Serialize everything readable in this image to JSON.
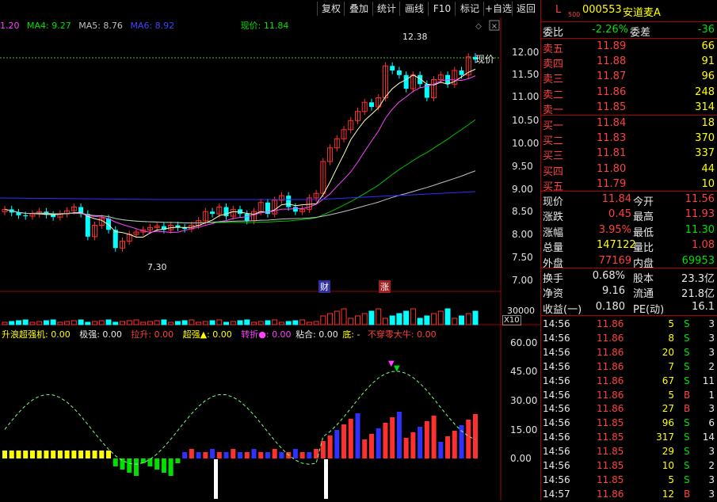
{
  "toolbar": {
    "buttons": [
      "复权",
      "叠加",
      "统计",
      "画线",
      "F10",
      "标记",
      "+自选",
      "返回"
    ]
  },
  "ma_legend": {
    "ma_prefix": "1.20",
    "ma4": "MA4: 9.27",
    "ma5": "MA5: 8.76",
    "ma6": "MA6: 8.92",
    "current_price_label": "现价: 11.84"
  },
  "price_axis": [
    "12.00",
    "11.50",
    "11.00",
    "10.50",
    "10.00",
    "9.50",
    "9.00",
    "8.50",
    "8.00",
    "7.50",
    "7.00"
  ],
  "annotations": {
    "high": "12.38",
    "low": "7.30",
    "now_tag": "现价",
    "badge_cai": "财",
    "badge_zhang": "涨"
  },
  "volume_axis": {
    "top": "30000",
    "multiplier": "X10"
  },
  "indicator_legend": {
    "item1": "升浪超强机: 0.00",
    "item2": "极强: 0.00",
    "item3": "拉升: 0.00",
    "item4": "超强▲: 0.00",
    "item5": "转折●: 0.00",
    "item6": "粘合: 0.00",
    "item7": "底: -",
    "item8": "不穿零大牛: 0.00"
  },
  "indicator_axis": [
    "60.00",
    "45.00",
    "30.00",
    "15.00",
    "0.00"
  ],
  "quote": {
    "prefix": "L",
    "sub": "500",
    "code": "000553",
    "name": "安道麦A",
    "weibi_label": "委比",
    "weibi_value": "-2.26%",
    "weicha_label": "委差",
    "weicha_value": "-36",
    "asks": [
      {
        "label": "卖五",
        "price": "11.89",
        "vol": "66"
      },
      {
        "label": "卖四",
        "price": "11.88",
        "vol": "91"
      },
      {
        "label": "卖三",
        "price": "11.87",
        "vol": "96"
      },
      {
        "label": "卖二",
        "price": "11.86",
        "vol": "248"
      },
      {
        "label": "卖一",
        "price": "11.85",
        "vol": "314"
      }
    ],
    "bids": [
      {
        "label": "买一",
        "price": "11.84",
        "vol": "18"
      },
      {
        "label": "买二",
        "price": "11.83",
        "vol": "370"
      },
      {
        "label": "买三",
        "price": "11.81",
        "vol": "337"
      },
      {
        "label": "买四",
        "price": "11.80",
        "vol": "44"
      },
      {
        "label": "买五",
        "price": "11.79",
        "vol": "10"
      }
    ],
    "stats": [
      {
        "l1": "现价",
        "v1": "11.84",
        "l2": "今开",
        "v2": "11.56"
      },
      {
        "l1": "涨跌",
        "v1": "0.45",
        "l2": "最高",
        "v2": "11.93"
      },
      {
        "l1": "涨幅",
        "v1": "3.95%",
        "l2": "最低",
        "v2": "11.30"
      },
      {
        "l1": "总量",
        "v1": "147122",
        "l2": "量比",
        "v2": "1.08"
      },
      {
        "l1": "外盘",
        "v1": "77169",
        "l2": "内盘",
        "v2": "69953"
      }
    ],
    "stats2": [
      {
        "l1": "换手",
        "v1": "0.68%",
        "l2": "股本",
        "v2": "23.3亿"
      },
      {
        "l1": "净资",
        "v1": "9.16",
        "l2": "流通",
        "v2": "21.8亿"
      },
      {
        "l1": "收益(一)",
        "v1": "0.180",
        "l2": "PE(动)",
        "v2": "16.1"
      }
    ]
  },
  "ticks": [
    {
      "t": "14:56",
      "p": "11.86",
      "v": "5",
      "s": "S",
      "n": "3"
    },
    {
      "t": "14:56",
      "p": "11.86",
      "v": "8",
      "s": "S",
      "n": "3"
    },
    {
      "t": "14:56",
      "p": "11.86",
      "v": "20",
      "s": "S",
      "n": "3"
    },
    {
      "t": "14:56",
      "p": "11.86",
      "v": "7",
      "s": "S",
      "n": "2"
    },
    {
      "t": "14:56",
      "p": "11.86",
      "v": "67",
      "s": "S",
      "n": "11"
    },
    {
      "t": "14:56",
      "p": "11.86",
      "v": "5",
      "s": "B",
      "n": "1"
    },
    {
      "t": "14:56",
      "p": "11.86",
      "v": "27",
      "s": "B",
      "n": "3"
    },
    {
      "t": "14:56",
      "p": "11.85",
      "v": "96",
      "s": "S",
      "n": "6"
    },
    {
      "t": "14:56",
      "p": "11.85",
      "v": "317",
      "s": "S",
      "n": "14"
    },
    {
      "t": "14:56",
      "p": "11.85",
      "v": "29",
      "s": "S",
      "n": "3"
    },
    {
      "t": "14:56",
      "p": "11.85",
      "v": "10",
      "s": "S",
      "n": "2"
    },
    {
      "t": "14:56",
      "p": "11.85",
      "v": "5",
      "s": "S",
      "n": "3"
    },
    {
      "t": "14:57",
      "p": "11.86",
      "v": "12",
      "s": "B",
      "n": "3"
    }
  ],
  "colors": {
    "up": "#ff3030",
    "down": "#00ffff",
    "ma1": "#ffffc0",
    "ma2": "#ff40ff",
    "ma3": "#00c000",
    "ma4": "#3030ff",
    "ma5": "#c0c0c0",
    "frame": "#a00000"
  }
}
